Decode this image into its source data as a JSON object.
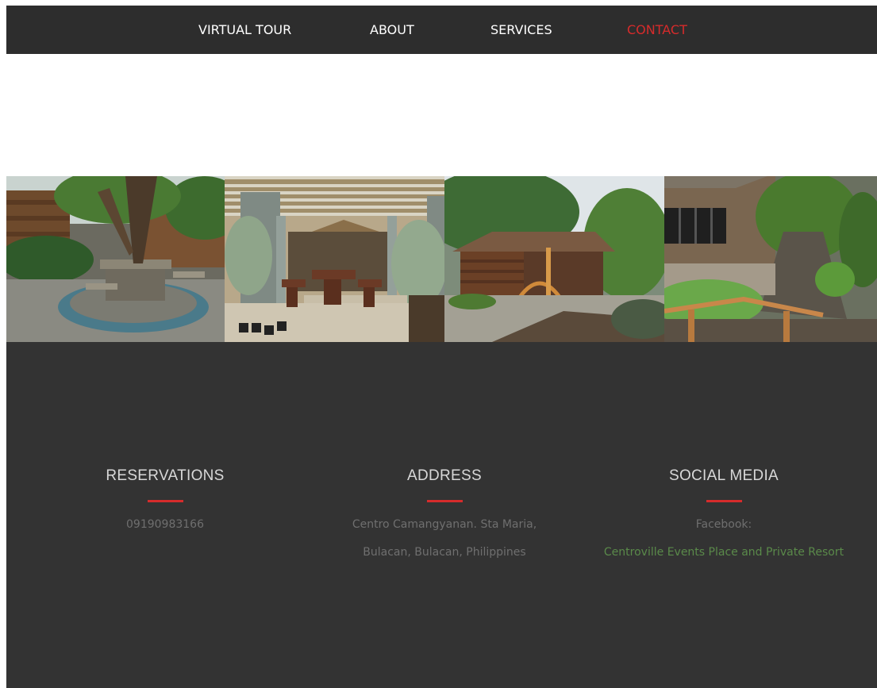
{
  "nav": {
    "items": [
      {
        "label": "VIRTUAL TOUR",
        "active": false
      },
      {
        "label": "ABOUT",
        "active": false
      },
      {
        "label": "SERVICES",
        "active": false
      },
      {
        "label": "CONTACT",
        "active": true
      }
    ],
    "active_color": "#d62b2b"
  },
  "gallery": {
    "photos": [
      {
        "alt": "tree-bench-photo"
      },
      {
        "alt": "pergola-dining-photo"
      },
      {
        "alt": "log-cabin-photo"
      },
      {
        "alt": "rock-fountain-garden-photo"
      }
    ]
  },
  "footer": {
    "reservations": {
      "title": "RESERVATIONS",
      "phone": "09190983166"
    },
    "address": {
      "title": "ADDRESS",
      "line1": "Centro Camangyanan. Sta Maria,",
      "line2": "Bulacan, Bulacan, Philippines"
    },
    "social": {
      "title": "SOCIAL MEDIA",
      "label": "Facebook:",
      "link_text": "Centroville Events Place and Private Resort"
    },
    "accent_color": "#d62b2b",
    "link_color": "#5a8a4a"
  }
}
